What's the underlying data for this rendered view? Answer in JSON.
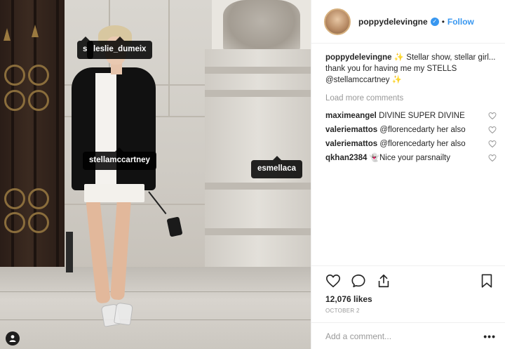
{
  "post": {
    "author": "poppydelevingne",
    "follow_label": "Follow",
    "separator": "•",
    "caption_user": "poppydelevingne",
    "caption_text": "✨ Stellar show, stellar girl... thank you for having me my STELLS @stellamccartney ✨",
    "load_more": "Load more comments",
    "comments": [
      {
        "user": "maximeangel",
        "text": "DIVINE SUPER DIVINE"
      },
      {
        "user": "valeriemattos",
        "text": "@florencedarty her also"
      },
      {
        "user": "valeriemattos",
        "text": "@florencedarty her also"
      },
      {
        "user": "qkhan2384",
        "text": "👻Nice your parsnailty"
      }
    ],
    "likes": "12,076 likes",
    "date": "OCTOBER 2",
    "comment_placeholder": "Add a comment...",
    "more_label": "•••"
  },
  "photo_tags": {
    "tag1": "leslie_dumeix",
    "tag1_prefix": "s",
    "tag2": "stellamccartney",
    "tag3": "esmellaca"
  },
  "icons": {
    "verified": "verified-badge-icon",
    "like": "heart-icon",
    "comment": "comment-bubble-icon",
    "share": "share-icon",
    "save": "bookmark-icon",
    "user_tags": "person-icon"
  },
  "colors": {
    "accent": "#3897f0",
    "text": "#262626",
    "muted": "#999999"
  }
}
